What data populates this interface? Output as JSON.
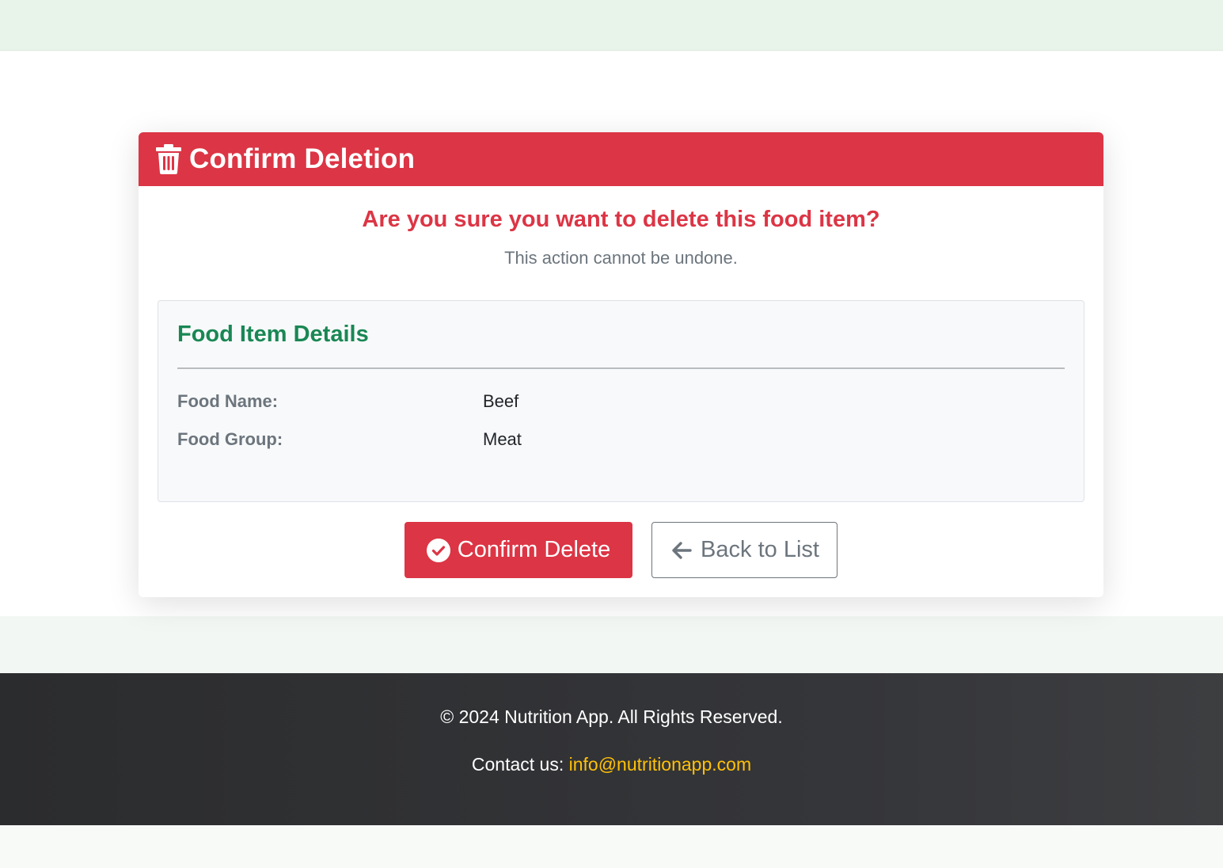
{
  "header": {
    "title": "Confirm Deletion",
    "icon": "trash-icon"
  },
  "prompt": {
    "question": "Are you sure you want to delete this food item?",
    "warning": "This action cannot be undone."
  },
  "details": {
    "title": "Food Item Details",
    "rows": [
      {
        "label": "Food Name:",
        "value": "Beef"
      },
      {
        "label": "Food Group:",
        "value": "Meat"
      }
    ]
  },
  "actions": {
    "confirm_label": "Confirm Delete",
    "confirm_icon": "check-circle-icon",
    "back_label": "Back to List",
    "back_icon": "arrow-left-icon"
  },
  "footer": {
    "copyright": "© 2024 Nutrition App. All Rights Reserved.",
    "contact_prefix": "Contact us: ",
    "email": "info@nutritionapp.com"
  },
  "colors": {
    "danger": "#dc3545",
    "success": "#198754",
    "accent": "#ffc107",
    "muted": "#6c757d"
  }
}
